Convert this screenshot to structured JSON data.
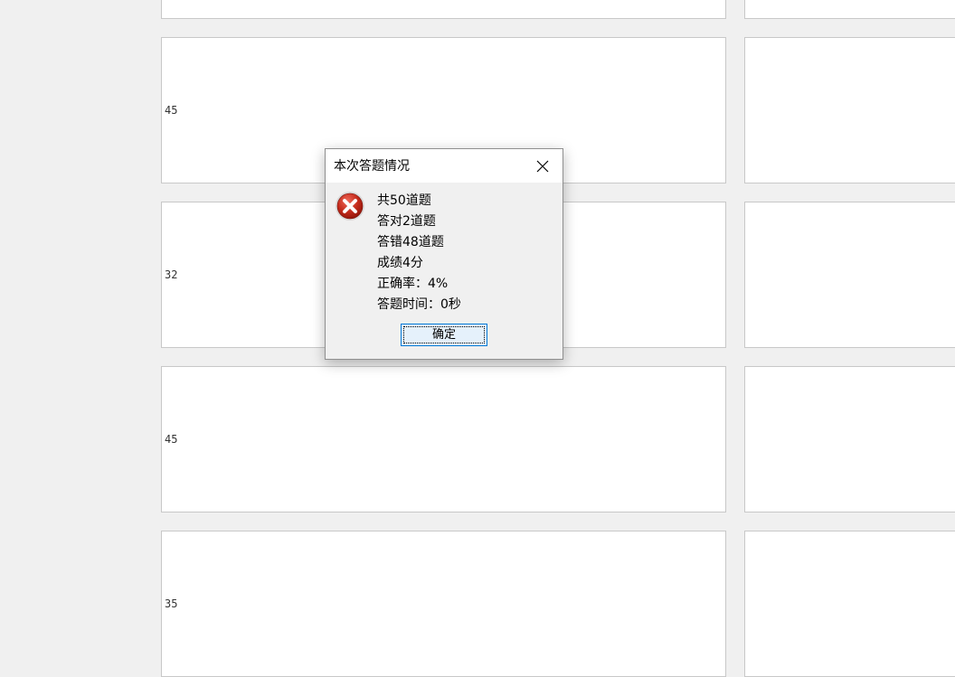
{
  "background_cards": {
    "labels": [
      "45",
      "32",
      "45",
      "35"
    ]
  },
  "dialog": {
    "title": "本次答题情况",
    "icon": "error-x-icon",
    "lines": [
      "共50道题",
      "答对2道题",
      "答错48道题",
      "成绩4分",
      "正确率：4%",
      "答题时间：0秒"
    ],
    "ok_label": "确定"
  },
  "colors": {
    "window_bg": "#f0f0f0",
    "card_bg": "#ffffff",
    "button_accent": "#0078d7",
    "error_red": "#c42b1c"
  }
}
